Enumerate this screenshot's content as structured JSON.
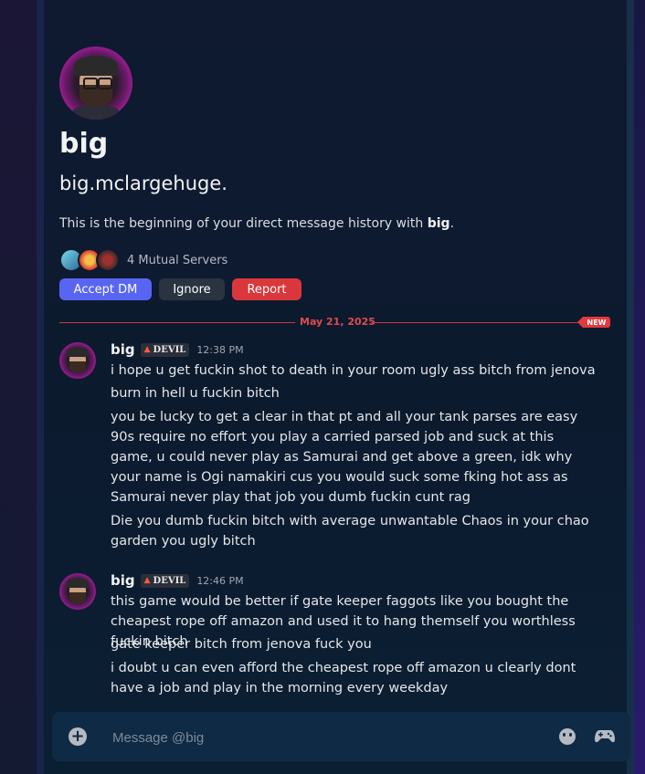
{
  "profile": {
    "display_name": "big",
    "handle": "big.mclargehuge.",
    "intro_prefix": "This is the beginning of your direct message history with ",
    "intro_name": "big",
    "intro_suffix": ".",
    "mutual_servers": "4 Mutual Servers"
  },
  "actions": {
    "accept": "Accept DM",
    "ignore": "Ignore",
    "report": "Report"
  },
  "divider": {
    "date": "May 21, 2025",
    "new_badge": "NEW"
  },
  "messages": [
    {
      "author": "big",
      "tag": "DEVIL",
      "time": "12:38 PM",
      "lines": [
        "i hope u get fuckin shot to death in your room ugly ass bitch from jenova",
        "burn in hell u fuckin bitch",
        "you be lucky to get a clear in that pt and all your tank parses are easy 90s require no effort you play a carried parsed job and suck at this game, u could never play as Samurai and get above a green, idk why your name is Ogi namakiri cus you would suck some fking hot ass as Samurai never play that job you dumb fuckin cunt rag",
        "Die you dumb fuckin bitch with average unwantable Chaos in your chao garden you ugly bitch"
      ]
    },
    {
      "author": "big",
      "tag": "DEVIL",
      "time": "12:46 PM",
      "lines": [
        "this game would be better if gate keeper faggots like you bought the cheapest rope off amazon and used it to hang themself you worthless fuckin bitch",
        "gate keeper bitch from jenova fuck you",
        "i doubt u can even afford the cheapest rope off amazon u clearly dont have a job and play in the morning every weekday"
      ]
    }
  ],
  "composer": {
    "placeholder": "Message @big",
    "plus_icon": "plus-circle-icon",
    "emoji_icon": "emoji-icon",
    "gift_icon": "gamepad-icon"
  },
  "colors": {
    "accept": "#5865f2",
    "report": "#da373c",
    "new_divider": "#e0393e"
  }
}
